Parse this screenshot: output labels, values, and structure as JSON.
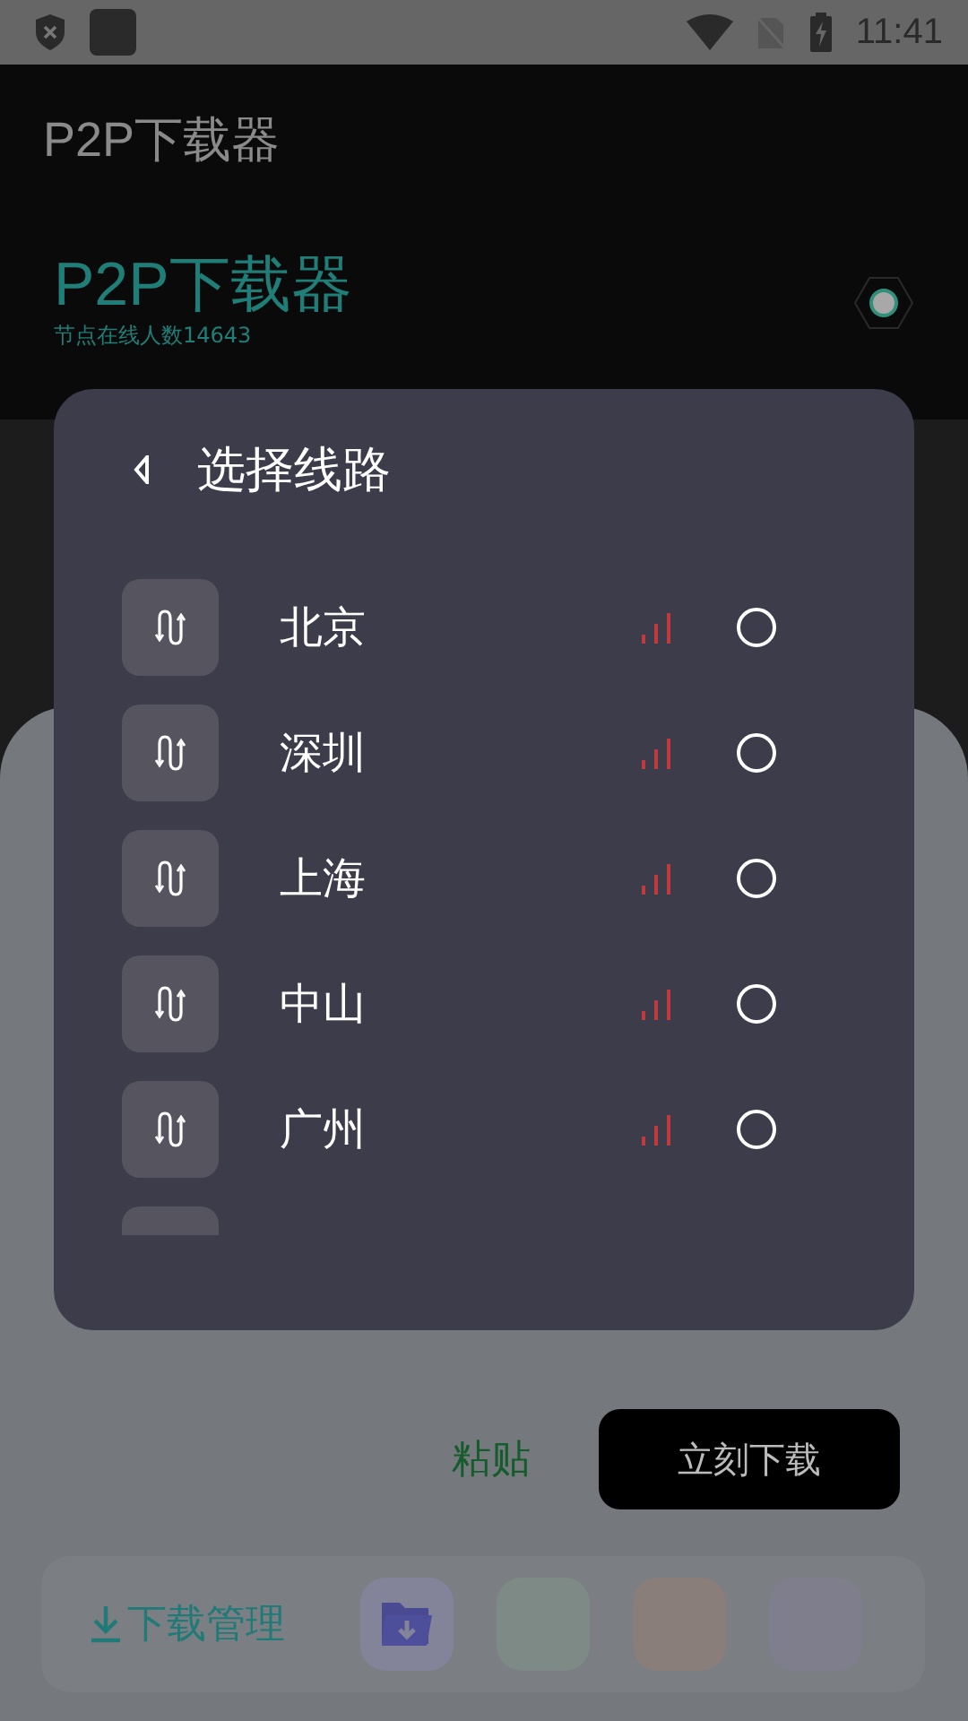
{
  "status_bar": {
    "time": "11:41"
  },
  "app_bar": {
    "title": "P2P下载器"
  },
  "header": {
    "title": "P2P下载器",
    "subtitle": "节点在线人数14643"
  },
  "dialog": {
    "title": "选择线路",
    "routes": [
      {
        "name": "北京",
        "selected": false
      },
      {
        "name": "深圳",
        "selected": false
      },
      {
        "name": "上海",
        "selected": false
      },
      {
        "name": "中山",
        "selected": false
      },
      {
        "name": "广州",
        "selected": false
      }
    ]
  },
  "actions": {
    "paste": "粘贴",
    "download": "立刻下载"
  },
  "bottom_bar": {
    "download_manager": "下载管理"
  }
}
